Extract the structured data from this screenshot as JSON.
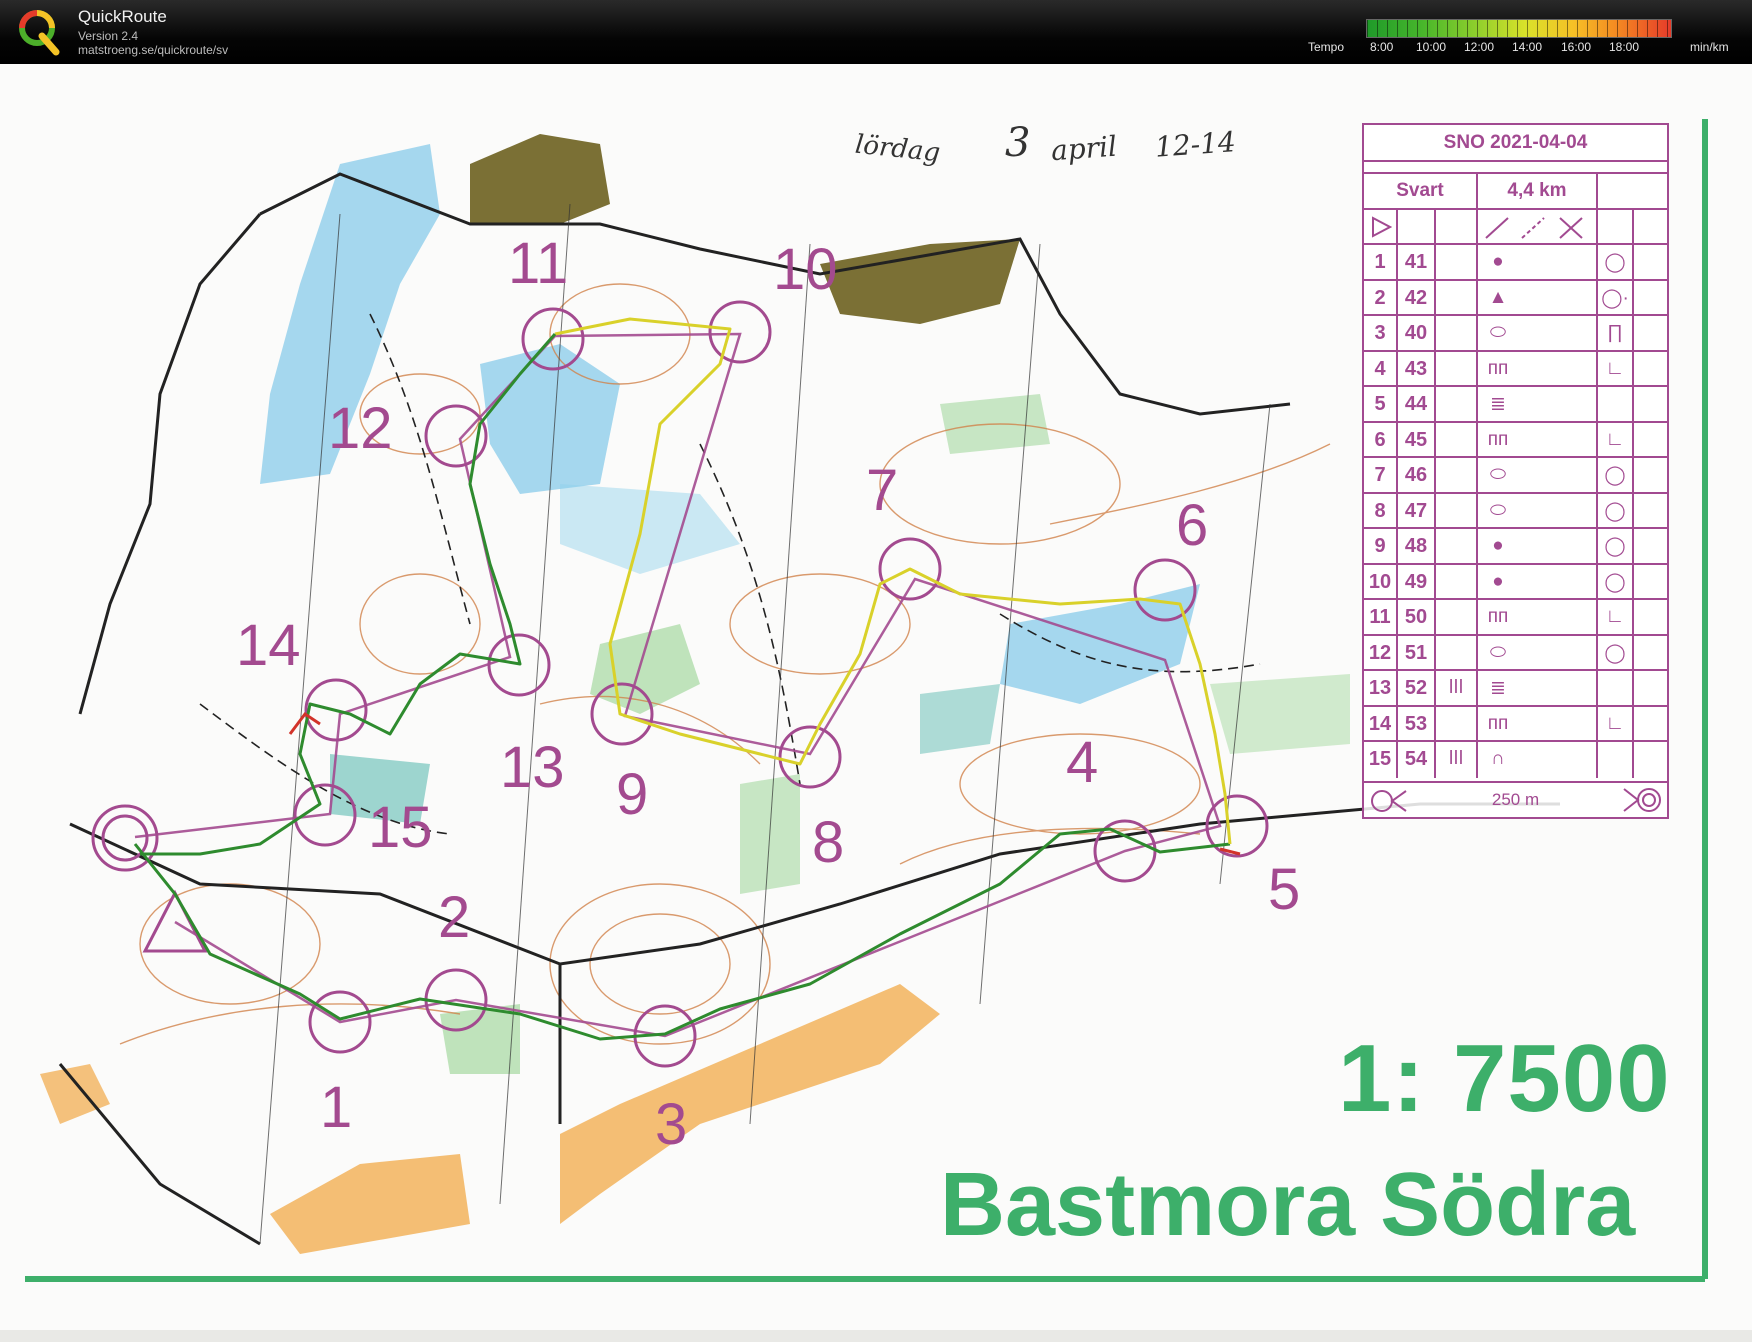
{
  "app": {
    "title": "QuickRoute",
    "version": "Version 2.4",
    "url": "matstroeng.se/quickroute/sv",
    "logo_icon": "quickroute-q-logo"
  },
  "tempo": {
    "label": "Tempo",
    "ticks": [
      "8:00",
      "10:00",
      "12:00",
      "14:00",
      "16:00",
      "18:00"
    ],
    "unit": "min/km",
    "colors": [
      "#1f9a2a",
      "#8fcf2c",
      "#d9e22a",
      "#f6c026",
      "#f48a22",
      "#e63b2a"
    ]
  },
  "handwriting": {
    "line_a": "lördag",
    "line_b": "3",
    "line_c": "april",
    "line_d": "12-14"
  },
  "map": {
    "scale": "1: 7500",
    "name": "Bastmora Södra",
    "course_color": "#a34a8f",
    "route_color": "#2e8b2e",
    "control_numbers": [
      "1",
      "2",
      "3",
      "4",
      "5",
      "6",
      "7",
      "8",
      "9",
      "10",
      "11",
      "12",
      "13",
      "14",
      "15"
    ]
  },
  "description": {
    "title": "SNO 2021-04-04",
    "class": "Svart",
    "length": "4,4 km",
    "controls": [
      {
        "num": "1",
        "code": "41",
        "feature": "●",
        "where": "◯"
      },
      {
        "num": "2",
        "code": "42",
        "feature": "▲",
        "where": "◯·"
      },
      {
        "num": "3",
        "code": "40",
        "feature": "⬭",
        "where": "∏"
      },
      {
        "num": "4",
        "code": "43",
        "feature": "ᴨᴨ",
        "where": "∟"
      },
      {
        "num": "5",
        "code": "44",
        "feature": "≣",
        "where": ""
      },
      {
        "num": "6",
        "code": "45",
        "feature": "ᴨᴨ",
        "where": "∟"
      },
      {
        "num": "7",
        "code": "46",
        "feature": "⬭",
        "where": "◯"
      },
      {
        "num": "8",
        "code": "47",
        "feature": "⬭",
        "where": "◯"
      },
      {
        "num": "9",
        "code": "48",
        "feature": "●",
        "where": "◯"
      },
      {
        "num": "10",
        "code": "49",
        "feature": "●",
        "where": "◯"
      },
      {
        "num": "11",
        "code": "50",
        "feature": "ᴨᴨ",
        "where": "∟"
      },
      {
        "num": "12",
        "code": "51",
        "feature": "⬭",
        "where": "◯"
      },
      {
        "num": "13",
        "code": "52",
        "feature": "≣",
        "where": "",
        "extra": "ǀǀǀ"
      },
      {
        "num": "14",
        "code": "53",
        "feature": "ᴨᴨ",
        "where": "∟"
      },
      {
        "num": "15",
        "code": "54",
        "feature": "∩",
        "where": "",
        "extra": "ǀǀǀ"
      }
    ],
    "distance": "250 m"
  }
}
